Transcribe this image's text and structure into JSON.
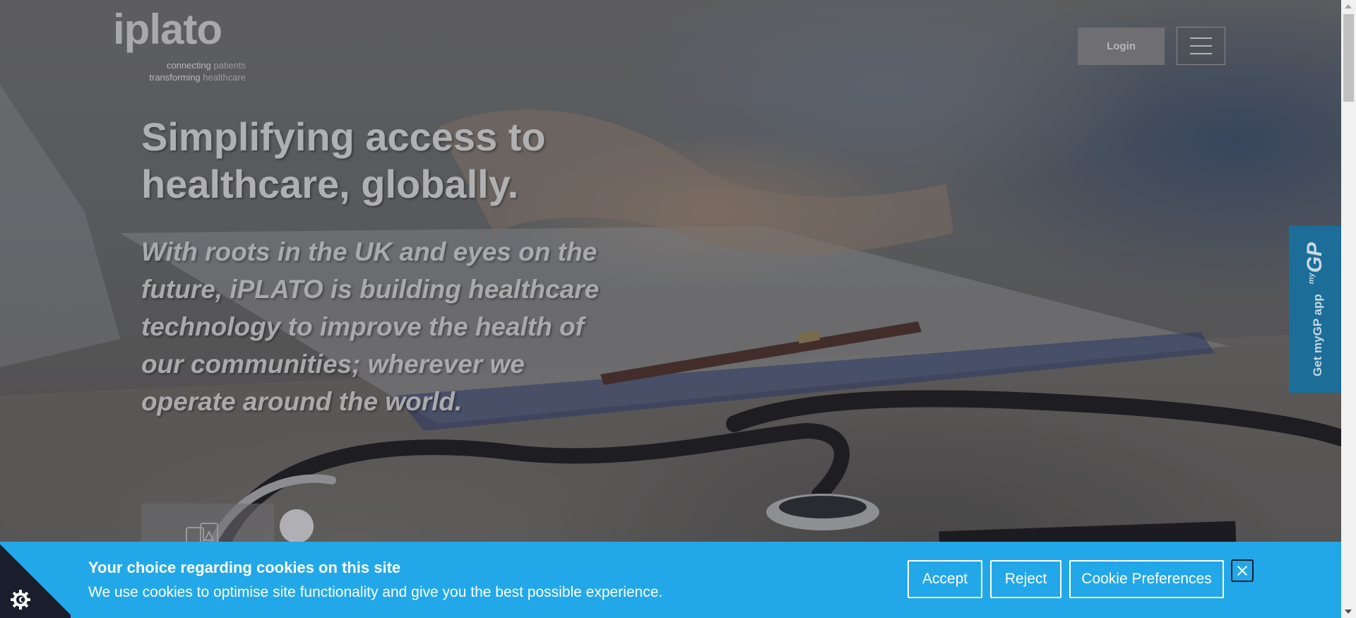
{
  "logo": {
    "wordmark": "iplato",
    "tagline_line1_strong": "connecting",
    "tagline_line1_rest": "patients",
    "tagline_line2_strong": "transforming",
    "tagline_line2_rest": "healthcare"
  },
  "header": {
    "login_label": "Login",
    "menu_icon": "hamburger-menu-icon"
  },
  "hero": {
    "headline": "Simplifying access to healthcare, globally.",
    "subline": "With roots in the UK and eyes on the future, iPLATO is building healthcare technology to improve the health of our communities; wherever we operate around the world."
  },
  "side_tab": {
    "label": "Get myGP app",
    "brand_prefix": "my",
    "brand": "GP",
    "color": "#1c6d98"
  },
  "cookie_banner": {
    "title": "Your choice regarding cookies on this site",
    "text": "We use cookies to optimise site functionality and give you the best possible experience.",
    "accept_label": "Accept",
    "reject_label": "Reject",
    "preferences_label": "Cookie Preferences",
    "close_icon": "close-icon",
    "settings_icon": "cookie-gear-icon",
    "background": "#22a8e8"
  }
}
